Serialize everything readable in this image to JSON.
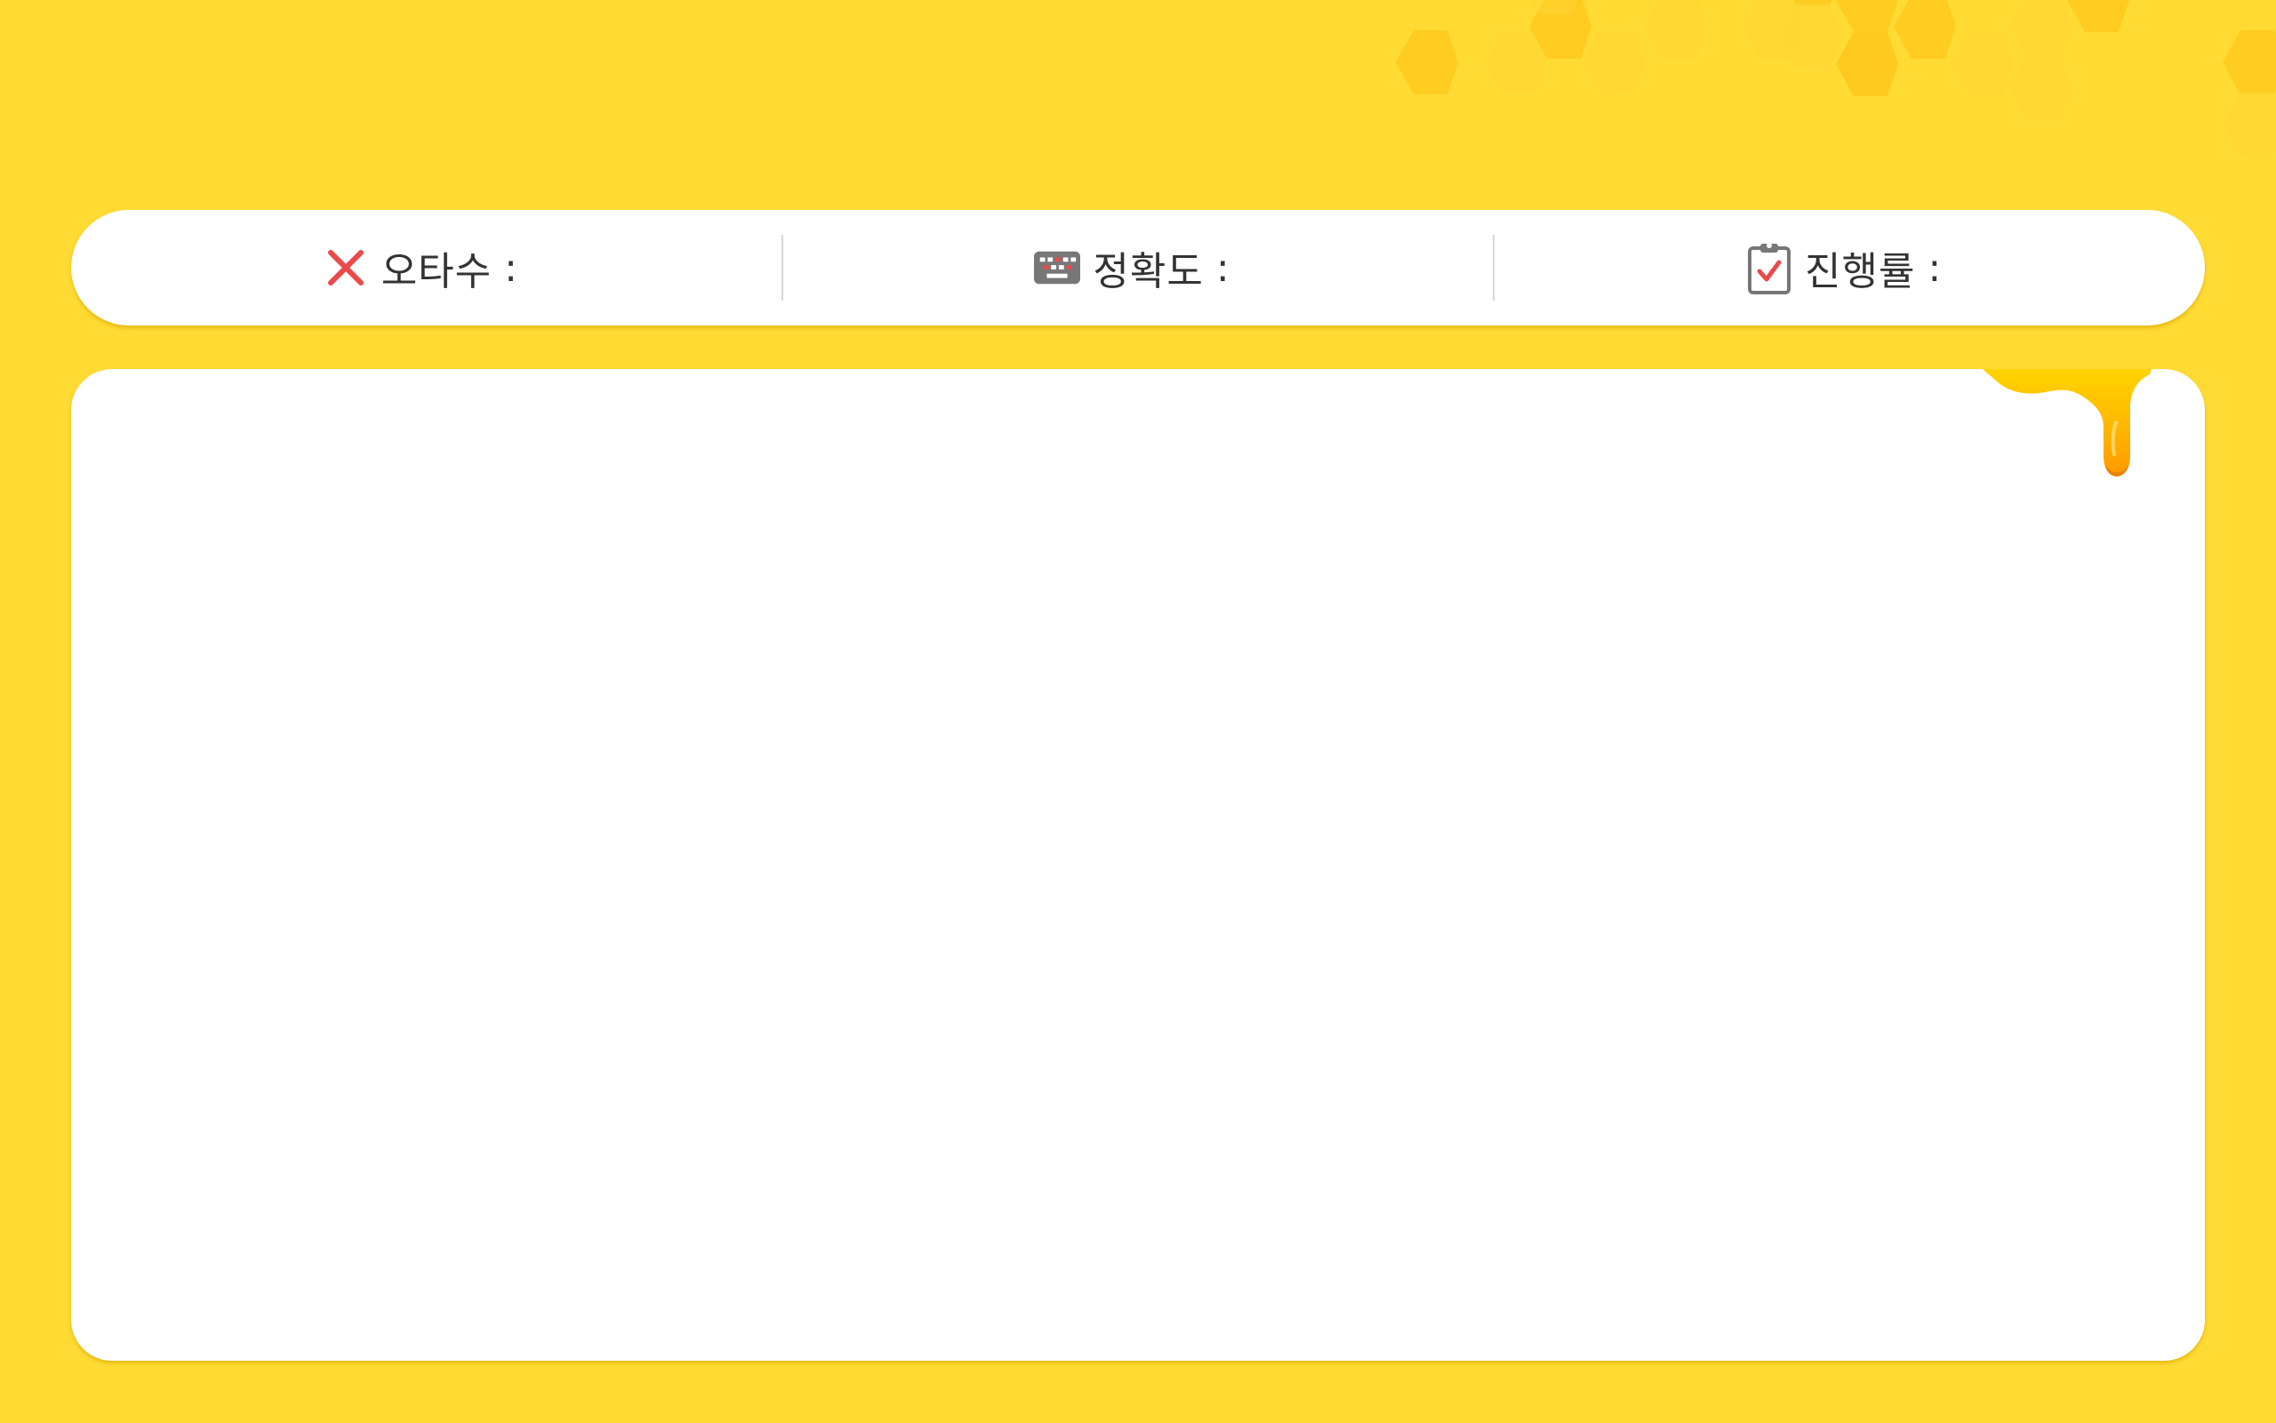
{
  "colors": {
    "background": "#FFDB33",
    "panel": "#FFFFFF",
    "text": "#333333",
    "typo_icon": "#E94B4B",
    "honey": "#FFB400"
  },
  "stats": {
    "typos": {
      "label": "오타수",
      "colon": ":",
      "value": "",
      "icon": "close-x-icon"
    },
    "accuracy": {
      "label": "정확도",
      "colon": ":",
      "value": "",
      "icon": "keyboard-icon"
    },
    "progress": {
      "label": "진행률",
      "colon": ":",
      "value": "",
      "icon": "clipboard-check-icon"
    }
  },
  "decorations": [
    "honeycomb-pattern",
    "honey-drip"
  ]
}
